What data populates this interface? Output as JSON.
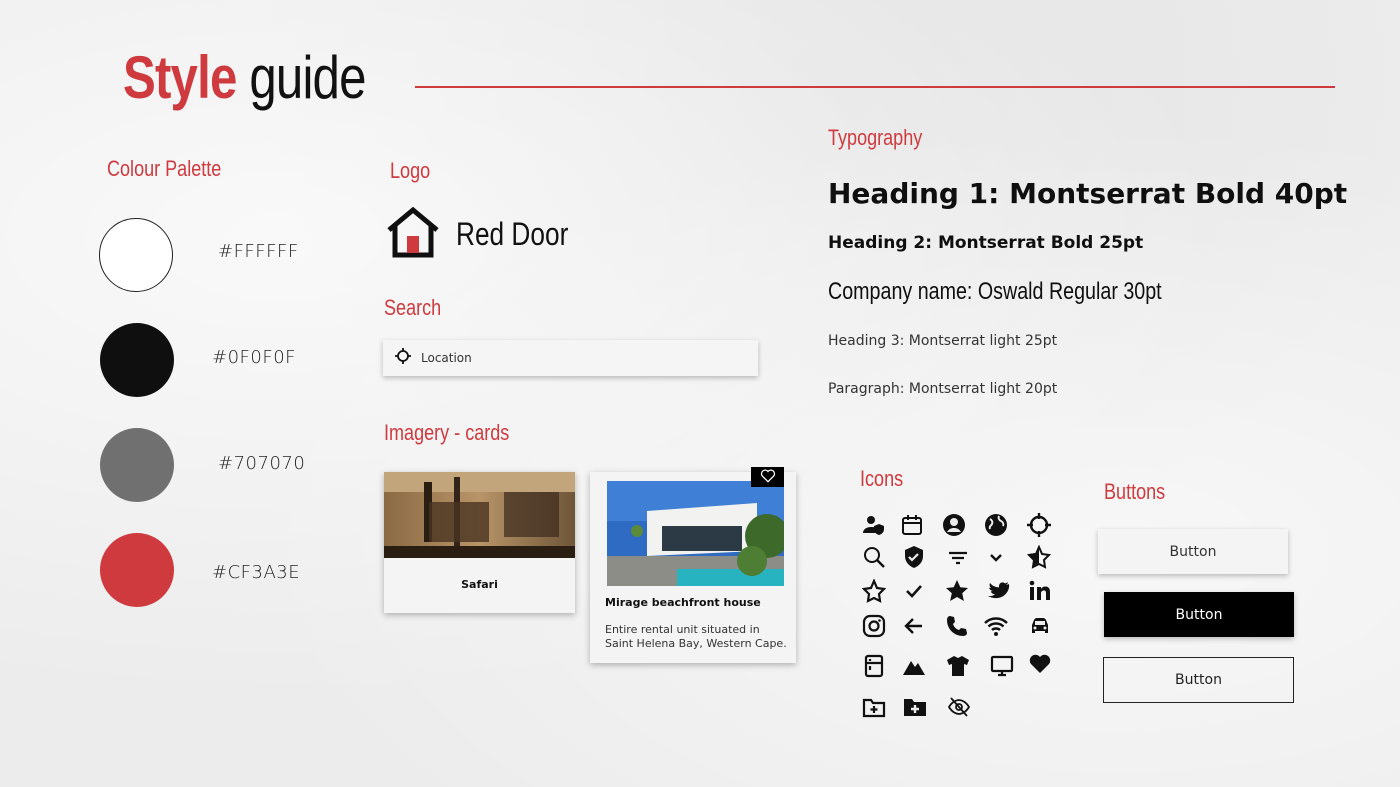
{
  "title": {
    "word1": "Style",
    "word2": " guide"
  },
  "palette": {
    "heading": "Colour Palette",
    "swatches": [
      {
        "hex": "#FFFFFF",
        "color": "#ffffff"
      },
      {
        "hex": "#0F0F0F",
        "color": "#0f0f0f"
      },
      {
        "hex": "#707070",
        "color": "#707070"
      },
      {
        "hex": "#CF3A3E",
        "color": "#cf3a3e"
      }
    ]
  },
  "logo": {
    "heading": "Logo",
    "name": "Red Door"
  },
  "search": {
    "heading": "Search",
    "placeholder": "Location"
  },
  "imagery": {
    "heading": "Imagery - cards",
    "cards": [
      {
        "title": "Safari"
      },
      {
        "title": "Mirage beachfront house",
        "desc": "Entire rental unit situated in Saint Helena Bay, Western Cape."
      }
    ]
  },
  "typography": {
    "heading": "Typography",
    "h1": "Heading 1: Montserrat Bold 40pt",
    "h2": "Heading 2: Montserrat Bold 25pt",
    "company": "Company name: Oswald Regular 30pt",
    "h3": "Heading 3: Montserrat light 25pt",
    "paragraph": "Paragraph: Montserrat light 20pt"
  },
  "icons": {
    "heading": "Icons",
    "names": [
      "user-shield-icon",
      "calendar-icon",
      "account-circle-icon",
      "globe-icon",
      "crosshair-icon",
      "search-icon",
      "shield-check-icon",
      "filter-icon",
      "chevron-down-icon",
      "star-half-icon",
      "star-outline-icon",
      "check-icon",
      "star-icon",
      "twitter-icon",
      "linkedin-icon",
      "instagram-icon",
      "arrow-left-icon",
      "phone-icon",
      "wifi-icon",
      "car-icon",
      "fridge-icon",
      "mountain-icon",
      "tshirt-icon",
      "monitor-icon",
      "heart-icon",
      "folder-plus-outline-icon",
      "folder-plus-icon",
      "eye-off-icon"
    ]
  },
  "buttons": {
    "heading": "Buttons",
    "labels": [
      "Button",
      "Button",
      "Button"
    ]
  }
}
